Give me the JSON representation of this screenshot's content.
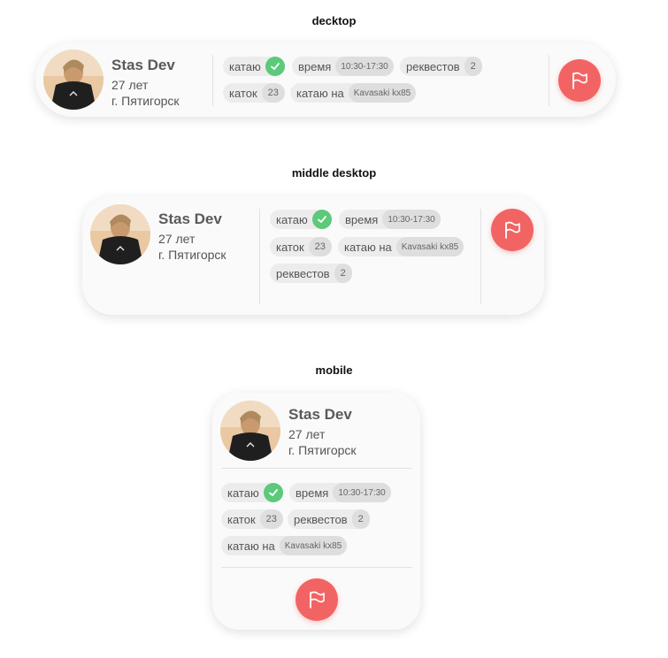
{
  "sections": {
    "desktop": "decktop",
    "middle": "middle desktop",
    "mobile": "mobile"
  },
  "profile": {
    "name": "Stas Dev",
    "age": "27 лет",
    "city": "г. Пятигорск"
  },
  "chips": {
    "riding_label": "катаю",
    "time_label": "время",
    "time_value": "10:30-17:30",
    "requests_label": "реквестов",
    "requests_value": "2",
    "rinks_label": "каток",
    "rinks_value": "23",
    "bike_label": "катаю на",
    "bike_value": "Kavasaki kx85"
  },
  "icons": {
    "riding_status": "check-badge-icon",
    "report": "flag-icon"
  },
  "colors": {
    "accent_red": "#f26464",
    "accent_green": "#5cc97b",
    "chip_bg": "#ececec",
    "chip_value_bg": "#dedede"
  }
}
